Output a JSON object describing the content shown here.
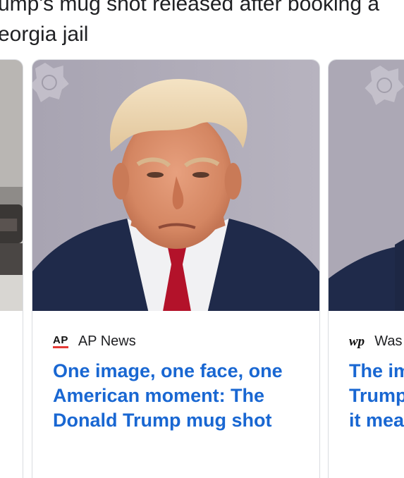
{
  "story": {
    "headline_lines": [
      "ump's mug shot released after booking a",
      "eorgia jail"
    ]
  },
  "cards": [
    {
      "source": "AP News",
      "logo_text": "AP",
      "title_lines": [
        "One image, one face, one",
        "American moment: The",
        "Donald Trump mug shot"
      ]
    },
    {
      "source": "Was",
      "logo_text": "wp",
      "title_lines": [
        "The im",
        "Trump",
        "it mea"
      ]
    }
  ],
  "colors": {
    "link": "#1967d2",
    "border": "#dadce0",
    "ap_red": "#e53935",
    "mugshot_backdrop": "#aeaab8"
  }
}
